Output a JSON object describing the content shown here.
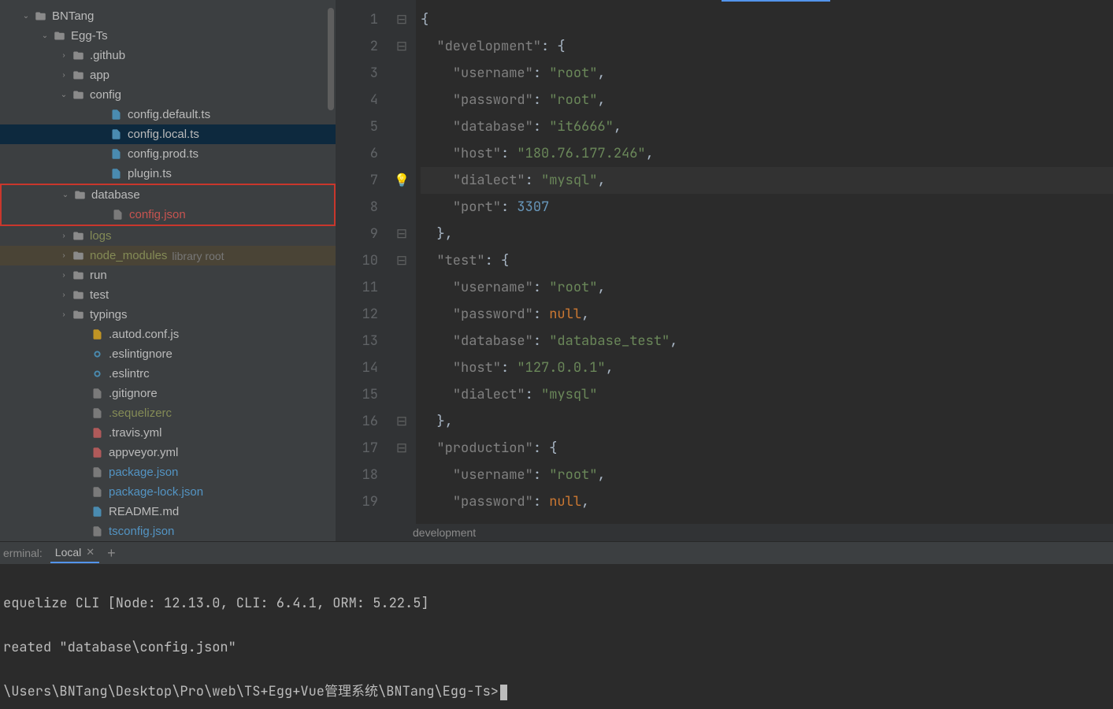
{
  "tree": {
    "root": "BNTang",
    "project": "Egg-Ts",
    "items": [
      {
        "label": ".github",
        "class": "",
        "chev": ">",
        "icon": "folder",
        "indent": 3
      },
      {
        "label": "app",
        "class": "",
        "chev": ">",
        "icon": "folder",
        "indent": 3
      },
      {
        "label": "config",
        "class": "",
        "chev": "v",
        "icon": "folder",
        "indent": 3
      },
      {
        "label": "config.default.ts",
        "class": "",
        "chev": "",
        "icon": "ts",
        "indent": 5
      },
      {
        "label": "config.local.ts",
        "class": "",
        "chev": "",
        "icon": "ts",
        "indent": 5,
        "sel": true
      },
      {
        "label": "config.prod.ts",
        "class": "",
        "chev": "",
        "icon": "ts",
        "indent": 5
      },
      {
        "label": "plugin.ts",
        "class": "",
        "chev": "",
        "icon": "ts",
        "indent": 5
      },
      {
        "label": "database",
        "class": "",
        "chev": "v",
        "icon": "folder",
        "indent": 3,
        "box": "top"
      },
      {
        "label": "config.json",
        "class": "red",
        "chev": "",
        "icon": "json",
        "indent": 5,
        "box": "bot"
      },
      {
        "label": "logs",
        "class": "oliv",
        "chev": ">",
        "icon": "folder",
        "indent": 3
      },
      {
        "label": "node_modules",
        "class": "oliv",
        "chev": ">",
        "icon": "folder",
        "indent": 3,
        "aux": "library root",
        "lib": true
      },
      {
        "label": "run",
        "class": "",
        "chev": ">",
        "icon": "folder",
        "indent": 3
      },
      {
        "label": "test",
        "class": "",
        "chev": ">",
        "icon": "folder",
        "indent": 3
      },
      {
        "label": "typings",
        "class": "",
        "chev": ">",
        "icon": "folder",
        "indent": 3
      },
      {
        "label": ".autod.conf.js",
        "class": "",
        "chev": "",
        "icon": "js",
        "indent": 4
      },
      {
        "label": ".eslintignore",
        "class": "",
        "chev": "",
        "icon": "circle",
        "indent": 4
      },
      {
        "label": ".eslintrc",
        "class": "",
        "chev": "",
        "icon": "circle",
        "indent": 4
      },
      {
        "label": ".gitignore",
        "class": "",
        "chev": "",
        "icon": "file",
        "indent": 4
      },
      {
        "label": ".sequelizerc",
        "class": "oliv",
        "chev": "",
        "icon": "file",
        "indent": 4
      },
      {
        "label": ".travis.yml",
        "class": "",
        "chev": "",
        "icon": "yml",
        "indent": 4
      },
      {
        "label": "appveyor.yml",
        "class": "",
        "chev": "",
        "icon": "yml",
        "indent": 4
      },
      {
        "label": "package.json",
        "class": "cyan",
        "chev": "",
        "icon": "json",
        "indent": 4
      },
      {
        "label": "package-lock.json",
        "class": "cyan",
        "chev": "",
        "icon": "json",
        "indent": 4
      },
      {
        "label": "README.md",
        "class": "",
        "chev": "",
        "icon": "md",
        "indent": 4
      },
      {
        "label": "tsconfig.json",
        "class": "cyan",
        "chev": "",
        "icon": "json",
        "indent": 4
      }
    ]
  },
  "code": {
    "lines": [
      [
        [
          "pu",
          "{"
        ]
      ],
      [
        [
          "pu",
          "  "
        ],
        [
          "str",
          "\"development\""
        ],
        [
          "pu",
          ": {"
        ]
      ],
      [
        [
          "pu",
          "    "
        ],
        [
          "str",
          "\"username\""
        ],
        [
          "pu",
          ": "
        ],
        [
          "strv",
          "\"root\""
        ],
        [
          "pu",
          ","
        ]
      ],
      [
        [
          "pu",
          "    "
        ],
        [
          "str",
          "\"password\""
        ],
        [
          "pu",
          ": "
        ],
        [
          "strv",
          "\"root\""
        ],
        [
          "pu",
          ","
        ]
      ],
      [
        [
          "pu",
          "    "
        ],
        [
          "str",
          "\"database\""
        ],
        [
          "pu",
          ": "
        ],
        [
          "strv",
          "\"it6666\""
        ],
        [
          "pu",
          ","
        ]
      ],
      [
        [
          "pu",
          "    "
        ],
        [
          "str",
          "\"host\""
        ],
        [
          "pu",
          ": "
        ],
        [
          "strv",
          "\"180.76.177.246\""
        ],
        [
          "pu",
          ","
        ]
      ],
      [
        [
          "pu",
          "    "
        ],
        [
          "str",
          "\"dialect\""
        ],
        [
          "pu",
          ": "
        ],
        [
          "strv",
          "\"mysql\""
        ],
        [
          "pu",
          ","
        ]
      ],
      [
        [
          "pu",
          "    "
        ],
        [
          "str",
          "\"port\""
        ],
        [
          "pu",
          ": "
        ],
        [
          "num",
          "3307"
        ]
      ],
      [
        [
          "pu",
          "  },"
        ]
      ],
      [
        [
          "pu",
          "  "
        ],
        [
          "str",
          "\"test\""
        ],
        [
          "pu",
          ": {"
        ]
      ],
      [
        [
          "pu",
          "    "
        ],
        [
          "str",
          "\"username\""
        ],
        [
          "pu",
          ": "
        ],
        [
          "strv",
          "\"root\""
        ],
        [
          "pu",
          ","
        ]
      ],
      [
        [
          "pu",
          "    "
        ],
        [
          "str",
          "\"password\""
        ],
        [
          "pu",
          ": "
        ],
        [
          "kw",
          "null"
        ],
        [
          "pu",
          ","
        ]
      ],
      [
        [
          "pu",
          "    "
        ],
        [
          "str",
          "\"database\""
        ],
        [
          "pu",
          ": "
        ],
        [
          "strv",
          "\"database_test\""
        ],
        [
          "pu",
          ","
        ]
      ],
      [
        [
          "pu",
          "    "
        ],
        [
          "str",
          "\"host\""
        ],
        [
          "pu",
          ": "
        ],
        [
          "strv",
          "\"127.0.0.1\""
        ],
        [
          "pu",
          ","
        ]
      ],
      [
        [
          "pu",
          "    "
        ],
        [
          "str",
          "\"dialect\""
        ],
        [
          "pu",
          ": "
        ],
        [
          "strv",
          "\"mysql\""
        ]
      ],
      [
        [
          "pu",
          "  },"
        ]
      ],
      [
        [
          "pu",
          "  "
        ],
        [
          "str",
          "\"production\""
        ],
        [
          "pu",
          ": {"
        ]
      ],
      [
        [
          "pu",
          "    "
        ],
        [
          "str",
          "\"username\""
        ],
        [
          "pu",
          ": "
        ],
        [
          "strv",
          "\"root\""
        ],
        [
          "pu",
          ","
        ]
      ],
      [
        [
          "pu",
          "    "
        ],
        [
          "str",
          "\"password\""
        ],
        [
          "pu",
          ": "
        ],
        [
          "kw",
          "null"
        ],
        [
          "pu",
          ","
        ]
      ]
    ],
    "cur": 7,
    "breadcrumb": "development"
  },
  "terminal": {
    "panel": "erminal:",
    "tab": "Local",
    "lines": [
      "",
      "equelize CLI [Node: 12.13.0, CLI: 6.4.1, ORM: 5.22.5]",
      "",
      "reated \"database\\config.json\"",
      "",
      "\\Users\\BNTang\\Desktop\\Pro\\web\\TS+Egg+Vue管理系统\\BNTang\\Egg-Ts>"
    ]
  }
}
